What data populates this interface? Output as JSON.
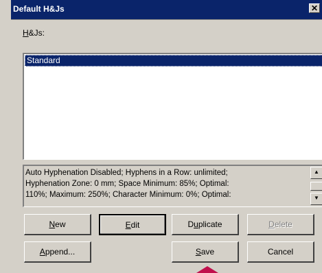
{
  "window": {
    "title": "Default H&Js",
    "close_label": "✕"
  },
  "hjs_label_underline": "H",
  "hjs_label_rest": "&Js:",
  "list": {
    "items": [
      "Standard"
    ]
  },
  "description_text": "Auto Hyphenation Disabled;  Hyphens in a Row: unlimited;\nHyphenation Zone: 0 mm;  Space Minimum: 85%;  Optimal:\n110%;  Maximum: 250%;  Character Minimum: 0%;  Optimal:",
  "buttons": {
    "new": {
      "u": "N",
      "rest": "ew"
    },
    "edit": {
      "u": "E",
      "rest": "dit"
    },
    "duplicate": {
      "pre": "D",
      "u": "u",
      "rest": "plicate"
    },
    "delete": {
      "u": "D",
      "rest": "elete"
    },
    "append": {
      "u": "A",
      "rest": "ppend..."
    },
    "save": {
      "u": "S",
      "rest": "ave"
    },
    "cancel": {
      "label": "Cancel"
    }
  },
  "colors": {
    "titlebar": "#0a246a",
    "selection": "#0a246a",
    "face": "#d4d0c8",
    "marker": "#c0104c"
  }
}
